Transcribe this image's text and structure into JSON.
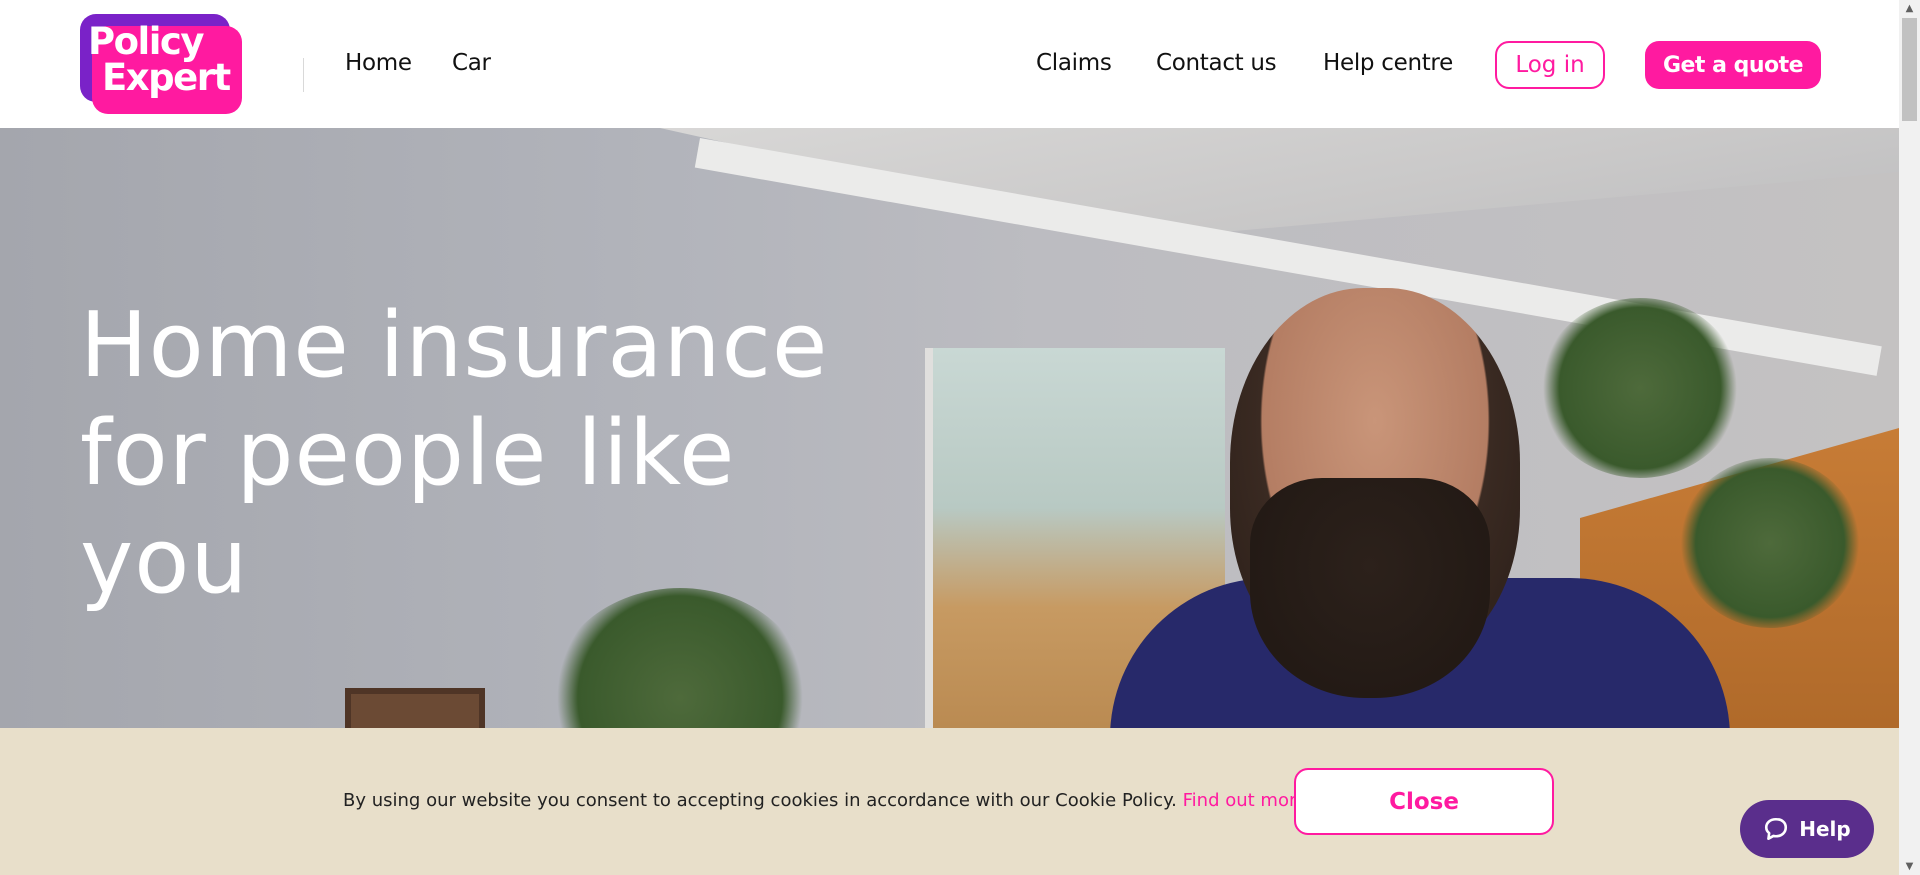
{
  "brand": {
    "logo_line1": "Policy",
    "logo_line2": "Expert",
    "primary_color": "#ff1aa0",
    "secondary_color": "#7a22c8"
  },
  "nav": {
    "left": [
      {
        "label": "Home"
      },
      {
        "label": "Car"
      }
    ],
    "right": [
      {
        "label": "Claims"
      },
      {
        "label": "Contact us"
      },
      {
        "label": "Help centre"
      }
    ],
    "login_label": "Log in",
    "quote_label": "Get a quote"
  },
  "hero": {
    "title_line1": "Home insurance",
    "title_line2": "for people like",
    "title_line3": "you"
  },
  "cookie_banner": {
    "text": "By using our website you consent to accepting cookies in accordance with our Cookie Policy.",
    "link_label": "Find out more",
    "close_label": "Close",
    "background_color": "#e8dfca"
  },
  "help_widget": {
    "label": "Help",
    "icon": "chat-bubble-icon",
    "color": "#5a2e8c"
  }
}
